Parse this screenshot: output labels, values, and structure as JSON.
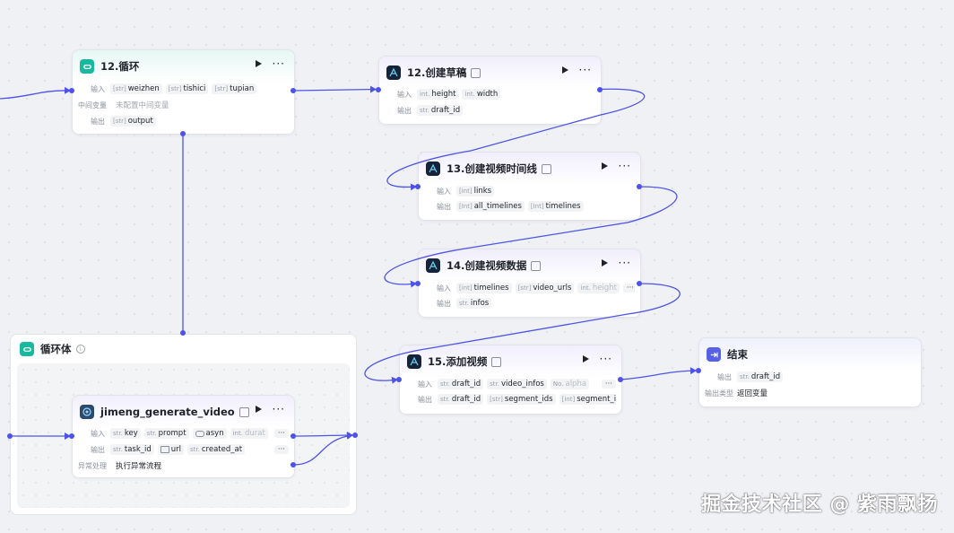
{
  "nodes": {
    "loop12": {
      "title": "12.循环",
      "input_label": "输入",
      "inputs": [
        {
          "type": "[str]",
          "name": "weizhen"
        },
        {
          "type": "[str]",
          "name": "tishici"
        },
        {
          "type": "[str]",
          "name": "tupian"
        }
      ],
      "mid_label": "中间变量",
      "mid_value": "未配置中间变量",
      "output_label": "输出",
      "outputs": [
        {
          "type": "[str]",
          "name": "output"
        }
      ]
    },
    "draft12": {
      "title": "12.创建草稿",
      "input_label": "输入",
      "inputs": [
        {
          "type": "int.",
          "name": "height"
        },
        {
          "type": "int.",
          "name": "width"
        }
      ],
      "output_label": "输出",
      "outputs": [
        {
          "type": "str.",
          "name": "draft_id"
        }
      ]
    },
    "timeline13": {
      "title": "13.创建视频时间线",
      "input_label": "输入",
      "inputs": [
        {
          "type": "[int]",
          "name": "links"
        }
      ],
      "output_label": "输出",
      "outputs": [
        {
          "type": "[Int]",
          "name": "all_timelines"
        },
        {
          "type": "[Int]",
          "name": "timelines"
        }
      ]
    },
    "videodata14": {
      "title": "14.创建视频数据",
      "input_label": "输入",
      "inputs": [
        {
          "type": "[int]",
          "name": "timelines"
        },
        {
          "type": "[str]",
          "name": "video_urls"
        },
        {
          "type": "int.",
          "name": "height"
        }
      ],
      "more": "···",
      "output_label": "输出",
      "outputs": [
        {
          "type": "str.",
          "name": "infos"
        }
      ]
    },
    "addvideo15": {
      "title": "15.添加视频",
      "input_label": "输入",
      "inputs": [
        {
          "type": "str.",
          "name": "draft_id"
        },
        {
          "type": "str.",
          "name": "video_infos"
        },
        {
          "type": "No.",
          "name": "alpha"
        }
      ],
      "more": "···",
      "output_label": "输出",
      "outputs": [
        {
          "type": "str.",
          "name": "draft_id"
        },
        {
          "type": "[str]",
          "name": "segment_ids"
        },
        {
          "type": "[int]",
          "name": "segment_infos"
        }
      ]
    },
    "end": {
      "title": "结束",
      "output_label": "输出",
      "outputs": [
        {
          "type": "str.",
          "name": "draft_id"
        }
      ],
      "output_type_label": "输出类型",
      "output_type_value": "返回变量"
    },
    "loopbody": {
      "title": "循环体",
      "info": "i"
    },
    "jimeng": {
      "title": "jimeng_generate_video",
      "input_label": "输入",
      "inputs": [
        {
          "type": "str.",
          "name": "key"
        },
        {
          "type": "str.",
          "name": "prompt"
        },
        {
          "type": "",
          "name": "asyn"
        },
        {
          "type": "int.",
          "name": "durat"
        }
      ],
      "more": "···",
      "output_label": "输出",
      "outputs": [
        {
          "type": "str.",
          "name": "task_id"
        },
        {
          "type": "",
          "name": "url"
        },
        {
          "type": "str.",
          "name": "created_at"
        }
      ],
      "error_label": "异常处理",
      "error_value": "执行异常流程"
    }
  },
  "actions": {
    "run": "run-icon",
    "more": "···"
  },
  "watermark": "掘金技术社区 @ 紫雨飘扬",
  "colors": {
    "edge": "#4d53e8",
    "loop_icon": "#19b9a0",
    "end_icon": "#5661e8"
  }
}
